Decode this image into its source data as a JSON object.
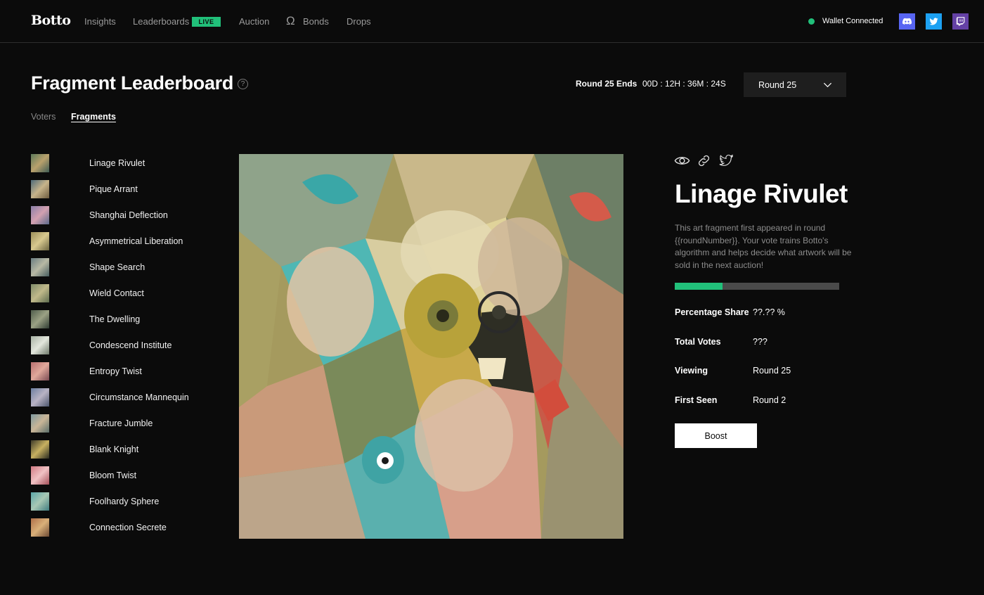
{
  "nav": {
    "logo": "Botto",
    "items": [
      {
        "label": "Insights"
      },
      {
        "label": "Leaderboards",
        "badge": "LIVE"
      },
      {
        "label": "Auction"
      },
      {
        "label": "Bonds",
        "icon": "omega-icon"
      },
      {
        "label": "Drops"
      }
    ],
    "wallet_status": "Wallet Connected",
    "social": [
      {
        "name": "discord-icon",
        "color": "#5865f2"
      },
      {
        "name": "twitter-icon",
        "color": "#1da1f2"
      },
      {
        "name": "twitch-icon",
        "color": "#6441a5"
      }
    ]
  },
  "header": {
    "title": "Fragment Leaderboard",
    "round_ends_label": "Round 25 Ends",
    "countdown": "00D : 12H : 36M : 24S",
    "round_select": "Round 25",
    "tabs": [
      {
        "label": "Voters",
        "active": false
      },
      {
        "label": "Fragments",
        "active": true
      }
    ]
  },
  "fragments": [
    {
      "name": "Linage Rivulet"
    },
    {
      "name": "Pique Arrant"
    },
    {
      "name": "Shanghai Deflection"
    },
    {
      "name": "Asymmetrical Liberation"
    },
    {
      "name": "Shape Search"
    },
    {
      "name": "Wield Contact"
    },
    {
      "name": "The Dwelling"
    },
    {
      "name": "Condescend Institute"
    },
    {
      "name": "Entropy Twist"
    },
    {
      "name": "Circumstance Mannequin"
    },
    {
      "name": "Fracture Jumble"
    },
    {
      "name": "Blank Knight"
    },
    {
      "name": "Bloom Twist"
    },
    {
      "name": "Foolhardy Sphere"
    },
    {
      "name": "Connection Secrete"
    }
  ],
  "detail": {
    "title": "Linage Rivulet",
    "description": "This art fragment first appeared in round {{roundNumber}}. Your vote trains Botto's algorithm and helps decide what artwork will be sold in the next auction!",
    "progress_fraction": 0.29,
    "stats": [
      {
        "label": "Percentage Share",
        "value": "??.?? %"
      },
      {
        "label": "Total Votes",
        "value": "???"
      },
      {
        "label": "Viewing",
        "value": "Round 25"
      },
      {
        "label": "First Seen",
        "value": "Round 2"
      }
    ],
    "boost_label": "Boost",
    "icons": [
      "eye-icon",
      "link-icon",
      "twitter-share-icon"
    ]
  },
  "colors": {
    "accent": "#21c07a",
    "background": "#0b0b0b"
  }
}
